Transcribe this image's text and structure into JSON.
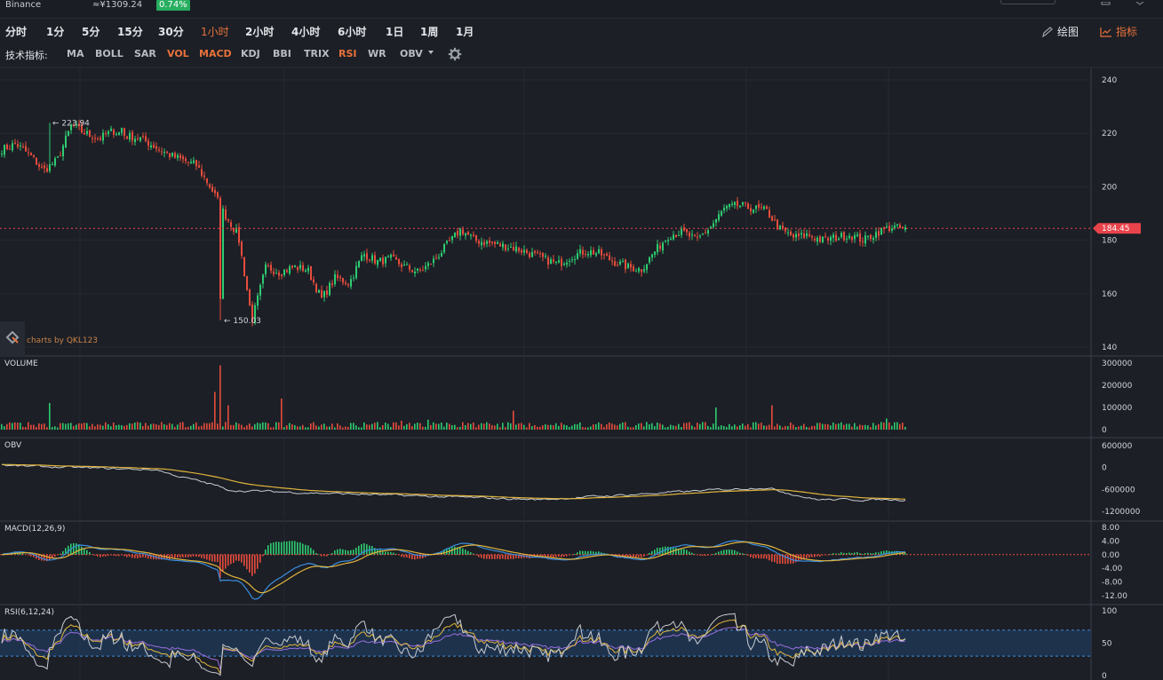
{
  "header": {
    "exchange": "Binance",
    "price": "≈¥1309.24",
    "change": "0.74%"
  },
  "intervals": [
    {
      "label": "分时",
      "active": false
    },
    {
      "label": "1分",
      "active": false
    },
    {
      "label": "5分",
      "active": false
    },
    {
      "label": "15分",
      "active": false
    },
    {
      "label": "30分",
      "active": false
    },
    {
      "label": "1小时",
      "active": true
    },
    {
      "label": "2小时",
      "active": false
    },
    {
      "label": "4小时",
      "active": false
    },
    {
      "label": "6小时",
      "active": false
    },
    {
      "label": "1日",
      "active": false
    },
    {
      "label": "1周",
      "active": false
    },
    {
      "label": "1月",
      "active": false
    }
  ],
  "tools": {
    "draw_label": "绘图",
    "indicator_label": "指标"
  },
  "indicator_bar": {
    "label": "技术指标:",
    "items": [
      {
        "label": "MA",
        "active": false
      },
      {
        "label": "BOLL",
        "active": false
      },
      {
        "label": "SAR",
        "active": false
      },
      {
        "label": "VOL",
        "active": true
      },
      {
        "label": "MACD",
        "active": true
      },
      {
        "label": "KDJ",
        "active": false
      },
      {
        "label": "BBI",
        "active": false
      },
      {
        "label": "TRIX",
        "active": false
      },
      {
        "label": "RSI",
        "active": true
      },
      {
        "label": "WR",
        "active": false
      },
      {
        "label": "OBV",
        "active": false
      }
    ]
  },
  "watermark": "charts by QKL123",
  "colors": {
    "up": "#2ecc71",
    "down": "#e74c3c",
    "accent": "#e8723a",
    "yellow": "#e0b43c",
    "white_line": "#c8ccd2",
    "blue": "#3b8ee0",
    "purple": "#9b6fe0",
    "price_tag": "#e8434b"
  },
  "chart_data": [
    {
      "type": "candlestick",
      "name": "price",
      "ylim": [
        140,
        240
      ],
      "yticks": [
        "240",
        "220",
        "200",
        "180",
        "160",
        "140"
      ],
      "current_price": "184.45",
      "annotations": [
        {
          "label": "← 223.94",
          "value": 223.94,
          "type": "high"
        },
        {
          "label": "← 150.03",
          "value": 150.03,
          "type": "low"
        }
      ],
      "approx_close_path": [
        214,
        216,
        212,
        206,
        210,
        223,
        220,
        218,
        221,
        219,
        218,
        215,
        212,
        210,
        208,
        200,
        190,
        182,
        150,
        170,
        168,
        170,
        169,
        158,
        166,
        164,
        175,
        172,
        173,
        170,
        168,
        172,
        178,
        184,
        180,
        179,
        178,
        177,
        175,
        173,
        171,
        174,
        176,
        175,
        172,
        170,
        169,
        176,
        182,
        183,
        180,
        185,
        192,
        193,
        192,
        191,
        184,
        181,
        182,
        180,
        181,
        182,
        180,
        183,
        185,
        184
      ]
    },
    {
      "type": "bar",
      "name": "VOLUME",
      "title": "VOLUME",
      "ylim": [
        0,
        300000
      ],
      "yticks": [
        "300000",
        "200000",
        "100000",
        "0"
      ]
    },
    {
      "type": "line",
      "name": "OBV",
      "title": "OBV",
      "ylim": [
        -1200000,
        600000
      ],
      "yticks": [
        "600000",
        "0",
        "-600000",
        "-1200000"
      ]
    },
    {
      "type": "line",
      "name": "MACD",
      "title": "MACD(12,26,9)",
      "ylim": [
        -12,
        8
      ],
      "yticks": [
        "8.00",
        "4.00",
        "0.00",
        "-4.00",
        "-8.00",
        "-12.00"
      ]
    },
    {
      "type": "line",
      "name": "RSI",
      "title": "RSI(6,12,24)",
      "ylim": [
        0,
        100
      ],
      "yticks": [
        "100",
        "50",
        "0"
      ],
      "bands": [
        30,
        70
      ]
    }
  ]
}
